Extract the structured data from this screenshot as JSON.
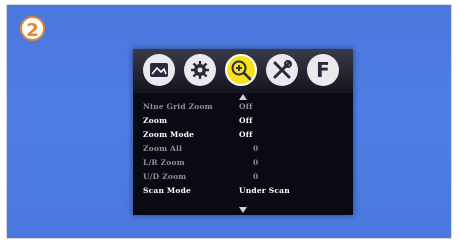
{
  "badge": {
    "label": "2"
  },
  "tabs": [
    {
      "icon": "picture-icon",
      "active": false
    },
    {
      "icon": "settings-icon",
      "active": false
    },
    {
      "icon": "zoom-in-icon",
      "active": true
    },
    {
      "icon": "tools-icon",
      "active": false
    },
    {
      "icon": "function-icon",
      "active": false,
      "label": "F"
    }
  ],
  "menu": {
    "rows": [
      {
        "label": "Nine Grid Zoom",
        "value": "Off",
        "state": "dim"
      },
      {
        "label": "Zoom",
        "value": "Off",
        "state": "normal"
      },
      {
        "label": "Zoom Mode",
        "value": "Off",
        "state": "normal"
      },
      {
        "label": "Zoom All",
        "value": "0",
        "state": "dim"
      },
      {
        "label": "L/R Zoom",
        "value": "0",
        "state": "dim"
      },
      {
        "label": "U/D Zoom",
        "value": "0",
        "state": "dim"
      },
      {
        "label": "Scan Mode",
        "value": "Under Scan",
        "state": "normal"
      }
    ]
  },
  "colors": {
    "background": "#4f7ee6",
    "osd_bg": "#0a0a14",
    "active_tab": "#f6e21a",
    "badge": "#e8862c"
  }
}
